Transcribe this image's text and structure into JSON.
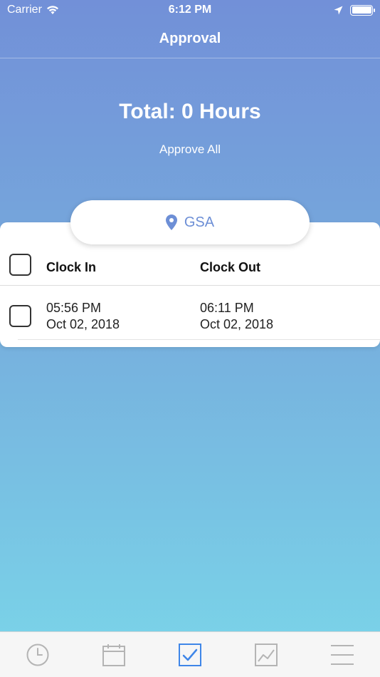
{
  "status_bar": {
    "carrier": "Carrier",
    "time": "6:12 PM"
  },
  "nav": {
    "title": "Approval"
  },
  "summary": {
    "total_label": "Total: 0 Hours",
    "approve_all_label": "Approve All"
  },
  "location": {
    "name": "GSA",
    "icon": "map-pin-icon"
  },
  "table": {
    "columns": [
      "Clock In",
      "Clock Out"
    ],
    "rows": [
      {
        "clock_in_time": "05:56 PM",
        "clock_in_date": "Oct 02, 2018",
        "clock_out_time": "06:11 PM",
        "clock_out_date": "Oct 02, 2018",
        "checked": false
      }
    ]
  },
  "tab_bar": {
    "tabs": [
      {
        "icon": "clock-icon",
        "active": false
      },
      {
        "icon": "calendar-icon",
        "active": false
      },
      {
        "icon": "approval-check-icon",
        "active": true
      },
      {
        "icon": "chart-icon",
        "active": false
      },
      {
        "icon": "menu-icon",
        "active": false
      }
    ]
  },
  "colors": {
    "gradient_top": "#7290d8",
    "gradient_bottom": "#7ad6e9",
    "accent": "#3f86e8",
    "location_text": "#6d8fd6",
    "tab_inactive": "#b4b4b4"
  }
}
